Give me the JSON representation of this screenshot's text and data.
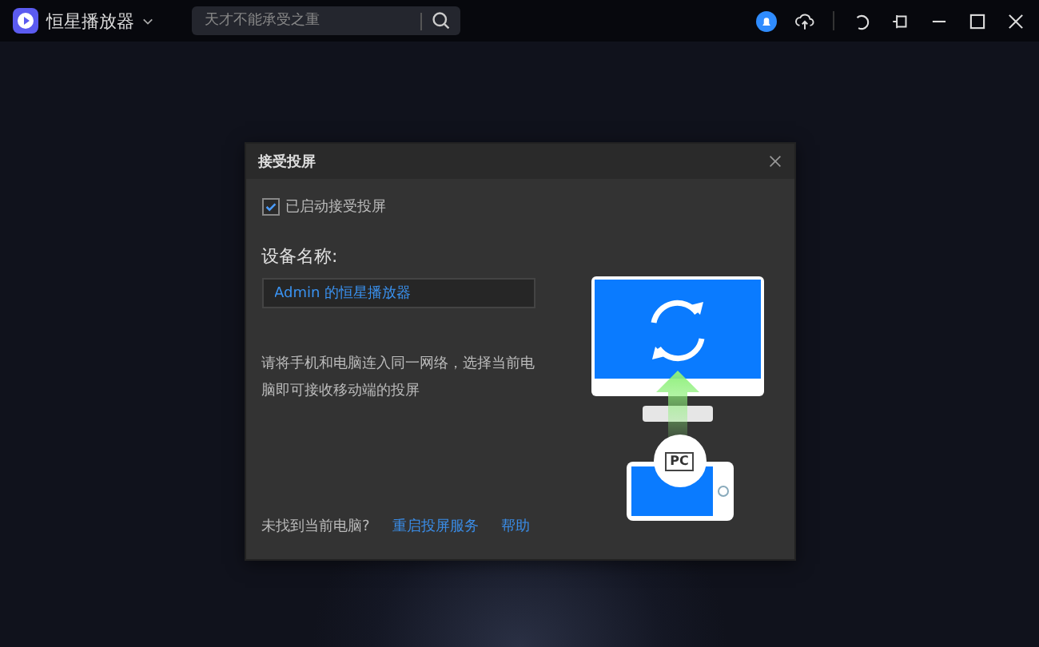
{
  "app": {
    "title": "恒星播放器"
  },
  "search": {
    "placeholder": "天才不能承受之重"
  },
  "dialog": {
    "title": "接受投屏",
    "enable": {
      "label": "已启动接受投屏",
      "checked": true
    },
    "device_label": "设备名称:",
    "device_name": "Admin 的恒星播放器",
    "hint": "请将手机和电脑连入同一网络，选择当前电脑即可接收移动端的投屏",
    "illustration_badge": "PC",
    "footer": {
      "question": "未找到当前电脑?",
      "links": [
        "重启投屏服务",
        "帮助"
      ]
    }
  }
}
